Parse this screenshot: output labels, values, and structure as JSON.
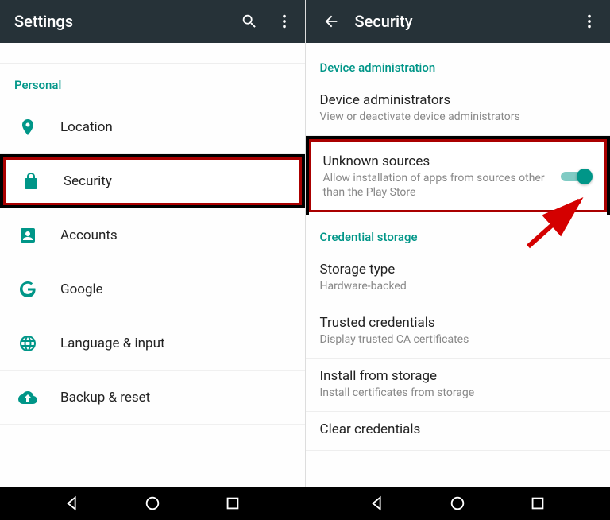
{
  "left": {
    "title": "Settings",
    "section": "Personal",
    "items": [
      {
        "label": "Location"
      },
      {
        "label": "Security"
      },
      {
        "label": "Accounts"
      },
      {
        "label": "Google"
      },
      {
        "label": "Language & input"
      },
      {
        "label": "Backup & reset"
      }
    ]
  },
  "right": {
    "title": "Security",
    "sections": {
      "device_admin_header": "Device administration",
      "device_admin": {
        "title": "Device administrators",
        "sub": "View or deactivate device administrators"
      },
      "unknown_sources": {
        "title": "Unknown sources",
        "sub": "Allow installation of apps from sources other than the Play Store",
        "enabled": true
      },
      "credential_header": "Credential storage",
      "storage_type": {
        "title": "Storage type",
        "sub": "Hardware-backed"
      },
      "trusted": {
        "title": "Trusted credentials",
        "sub": "Display trusted CA certificates"
      },
      "install": {
        "title": "Install from storage",
        "sub": "Install certificates from storage"
      },
      "clear": {
        "title": "Clear credentials"
      }
    }
  }
}
